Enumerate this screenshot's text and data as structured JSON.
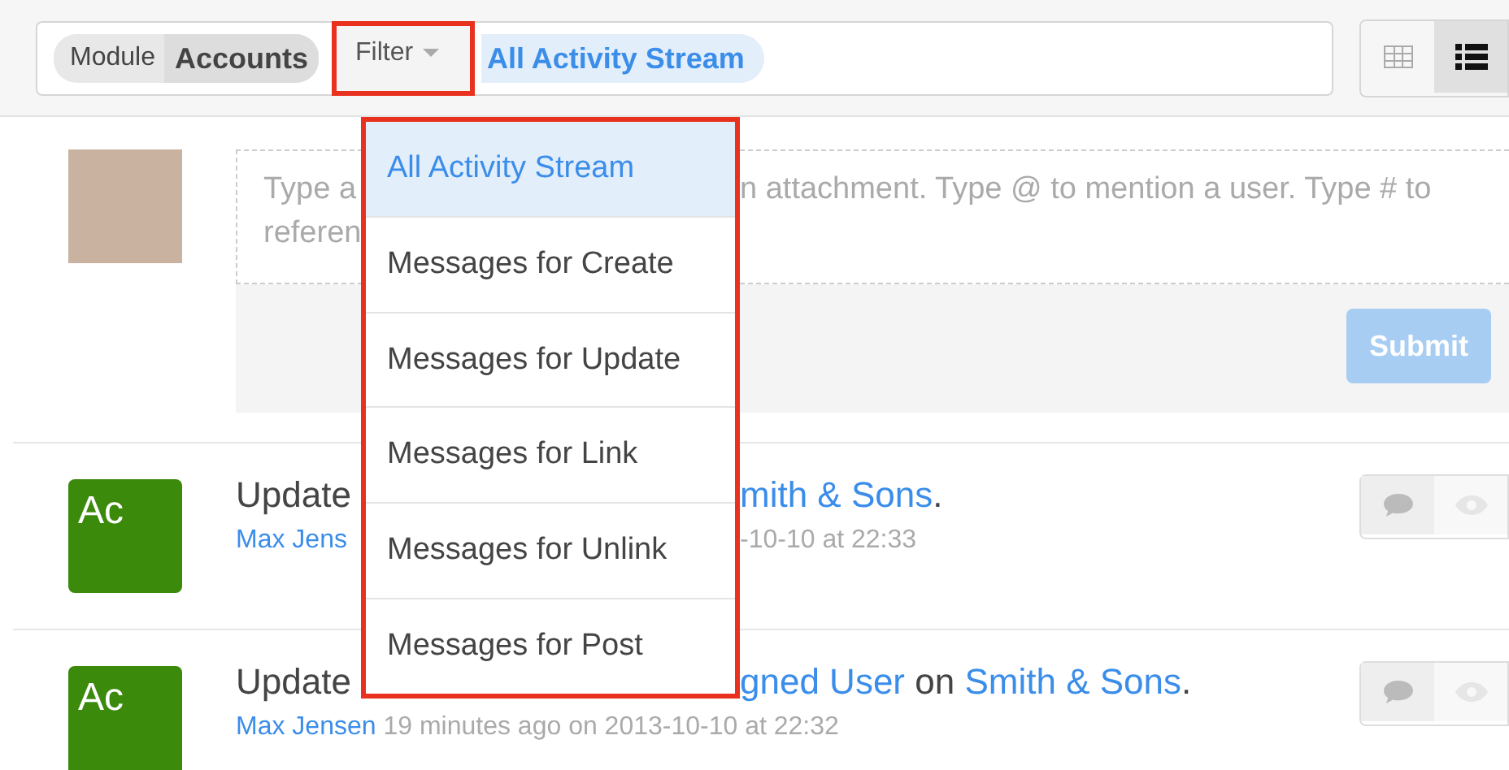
{
  "toolbar": {
    "module_label": "Module",
    "module_value": "Accounts",
    "filter": {
      "label": "Filter",
      "highlighted": true
    },
    "active_filter": "All Activity Stream",
    "views": [
      {
        "kind": "table",
        "selected": false
      },
      {
        "kind": "list",
        "selected": true
      }
    ]
  },
  "composer": {
    "lines": [
      [
        {
          "kind": "hint",
          "text": "Type a"
        },
        {
          "kind": "gap"
        },
        {
          "kind": "hint",
          "text": "n attachment. Type @ to mention a user. Type # to"
        }
      ],
      [
        {
          "kind": "hint",
          "text": "referen"
        }
      ]
    ],
    "submit": "Submit"
  },
  "activities": [
    {
      "badge": "Ac",
      "headline": [
        {
          "kind": "plain",
          "text": "Update"
        },
        {
          "kind": "gap"
        },
        {
          "kind": "link",
          "text": "mith & Sons"
        },
        {
          "kind": "plain",
          "text": "."
        }
      ],
      "meta": [
        {
          "kind": "link",
          "text": "Max Jens"
        },
        {
          "kind": "gap"
        },
        {
          "kind": "muted",
          "text": "-10-10 at 22:33"
        }
      ]
    },
    {
      "badge": "Ac",
      "headline": [
        {
          "kind": "plain",
          "text": "Update"
        },
        {
          "kind": "gap"
        },
        {
          "kind": "link",
          "text": "gned User"
        },
        {
          "kind": "plain",
          "text": " on "
        },
        {
          "kind": "link",
          "text": "Smith & Sons"
        },
        {
          "kind": "plain",
          "text": "."
        }
      ],
      "meta": [
        {
          "kind": "link",
          "text": "Max Jensen"
        },
        {
          "kind": "muted",
          "text": " 19 minutes ago on 2013-10-10 at 22:32"
        }
      ]
    }
  ],
  "dropdown": {
    "highlighted": true,
    "items": [
      {
        "label": "All Activity Stream",
        "selected": true
      },
      {
        "label": "Messages for Create",
        "selected": false
      },
      {
        "label": "Messages for Update",
        "selected": false
      },
      {
        "label": "Messages for Link",
        "selected": false
      },
      {
        "label": "Messages for Unlink",
        "selected": false
      },
      {
        "label": "Messages for Post",
        "selected": false
      }
    ]
  }
}
